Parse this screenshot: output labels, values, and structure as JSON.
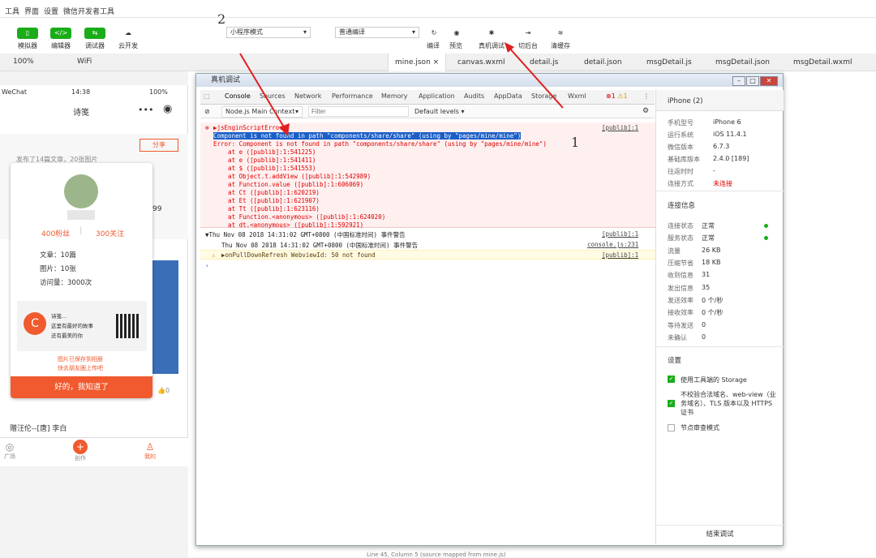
{
  "menu": [
    "工具",
    "界面",
    "设置",
    "微信开发者工具"
  ],
  "toolbar": {
    "items": [
      {
        "icon": "mobile-icon",
        "label": "模拟器"
      },
      {
        "icon": "code-icon",
        "label": "编辑器"
      },
      {
        "icon": "debugger-icon",
        "label": "调试器"
      },
      {
        "icon": "cloud-icon",
        "label": "云开发"
      }
    ],
    "mode_select": "小程序模式",
    "compile_select": "普通编译",
    "actions": [
      {
        "icon": "refresh-icon",
        "label": "编译"
      },
      {
        "icon": "eye-icon",
        "label": "预览"
      },
      {
        "icon": "bug-icon",
        "label": "真机调试"
      },
      {
        "icon": "switch-icon",
        "label": "切后台"
      },
      {
        "icon": "layers-icon",
        "label": "清缓存"
      }
    ]
  },
  "tabbar": {
    "zoom": "100%",
    "network": "WiFi",
    "files": [
      "mine.json",
      "canvas.wxml",
      "detail.js",
      "detail.json",
      "msgDetail.js",
      "msgDetail.json",
      "msgDetail.wxml"
    ]
  },
  "annotations": {
    "a1": "1",
    "a2": "2"
  },
  "phone": {
    "carrier": "WeChat",
    "time": "14:38",
    "battery": "100%",
    "title": "诗笺",
    "share": "分享",
    "summary": "发布了14篇文章，20张图片",
    "right_count": "99",
    "bottom_text": "赠汪伦--[唐] 李白",
    "like_count": "0",
    "tabs": [
      {
        "icon": "compass-icon",
        "label": "广场"
      },
      {
        "icon": "plus-icon",
        "label": "创作"
      },
      {
        "icon": "user-icon",
        "label": "我的"
      }
    ]
  },
  "card": {
    "fans": "400粉丝",
    "follows": "300关注",
    "articles": "文章：10篇",
    "images": "图片：10张",
    "visits": "访问量：3000次",
    "logo_name": "诗笺...",
    "slogan1": "这里有最好的故事",
    "slogan2": "还有最美的你",
    "saved": "图片已保存到相册",
    "hint": "快去朋友圈上传吧",
    "ok": "好的，我知道了"
  },
  "devwin": {
    "title": "真机调试",
    "tabs": [
      "Console",
      "Sources",
      "Network",
      "Performance",
      "Memory",
      "Application",
      "Audits",
      "AppData",
      "Storage",
      "Wxml"
    ],
    "err_count": "1",
    "warn_count": "1",
    "context": "Node.js Main Context",
    "filter_placeholder": "Filter",
    "levels": "Default levels",
    "lines": [
      "▶jsEnginScriptError",
      "Component is not found in path \"components/share/share\" (using by \"pages/mine/mine\")",
      "Error: Component is not found in path \"components/share/share\" (using by \"pages/mine/mine\")",
      "    at e ([publib]:1:541225)",
      "    at e ([publib]:1:541411)",
      "    at $ ([publib]:1:541553)",
      "    at Object.t.addView ([publib]:1:542989)",
      "    at Function.value ([publib]:1:606069)",
      "    at Ct ([publib]:1:620219)",
      "    at Et ([publib]:1:621907)",
      "    at Tt ([publib]:1:623116)",
      "    at Function.<anonymous> ([publib]:1:624020)",
      "    at dt.<anonymous> ([publib]:1:592921)"
    ],
    "src1": "[publib]:1",
    "group": "▼Thu Nov 08 2018 14:31:02 GMT+0800 (中国标准时间) 事件警告",
    "group_line": "Thu Nov 08 2018 14:31:02 GMT+0800 (中国标准时间) 事件警告",
    "src2": "[publib]:1",
    "src3": "console.js:231",
    "warn": "▶onPullDownRefresh WebviewId: 50 not found",
    "src4": "[publib]:1",
    "device": "iPhone (2)",
    "info": [
      [
        "手机型号",
        "iPhone 6"
      ],
      [
        "运行系统",
        "iOS 11.4.1"
      ],
      [
        "微信版本",
        "6.7.3"
      ],
      [
        "基础库版本",
        "2.4.0 [189]"
      ],
      [
        "往返时时",
        "-"
      ],
      [
        "连接方式",
        "未连接"
      ]
    ],
    "conn_title": "连接信息",
    "conn": [
      [
        "连接状态",
        "正常"
      ],
      [
        "服务状态",
        "正常"
      ],
      [
        "流量",
        "26 KB"
      ],
      [
        "压缩节省",
        "18 KB"
      ],
      [
        "收到信息",
        "31"
      ],
      [
        "发出信息",
        "35"
      ],
      [
        "发送效率",
        "0 个/秒"
      ],
      [
        "接收效率",
        "0 个/秒"
      ],
      [
        "等待发送",
        "0"
      ],
      [
        "未确认",
        "0"
      ]
    ],
    "settings_title": "设置",
    "s1": "使用工具端的 Storage",
    "s2": "不校验合法域名、web-view（业务域名）、TLS 版本以及 HTTPS 证书",
    "s3": "节点审查模式",
    "end": "结束调试"
  },
  "status": "Line 45, Column 5  (source mapped from mine.js)"
}
